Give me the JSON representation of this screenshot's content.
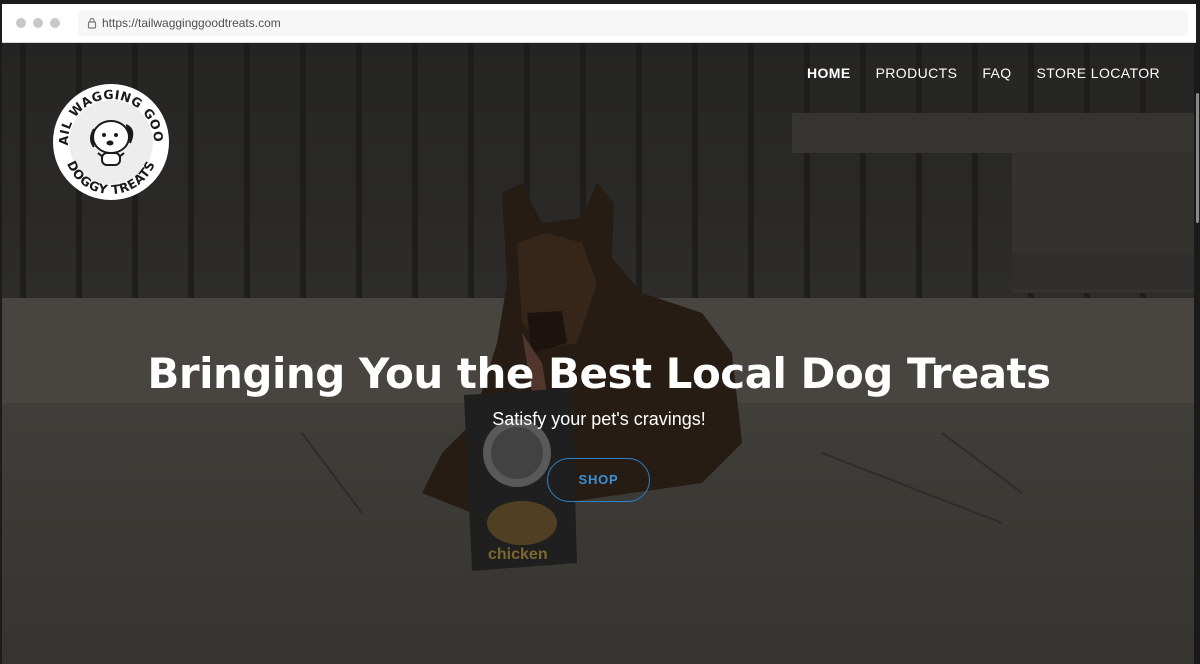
{
  "browser": {
    "url": "https://tailwagginggoodtreats.com"
  },
  "logo": {
    "top_text": "TAIL WAGGING GOOD",
    "bottom_text": "DOGGY TREATS"
  },
  "nav": {
    "items": [
      {
        "label": "HOME",
        "active": true
      },
      {
        "label": "PRODUCTS",
        "active": false
      },
      {
        "label": "FAQ",
        "active": false
      },
      {
        "label": "STORE LOCATOR",
        "active": false
      }
    ]
  },
  "hero": {
    "headline": "Bringing You the Best Local Dog Treats",
    "subheadline": "Satisfy your pet's cravings!",
    "cta_label": "SHOP",
    "bag_label": "chicken"
  },
  "colors": {
    "accent": "#3b8fd6",
    "overlay": "#0a0a0a",
    "text": "#ffffff"
  }
}
